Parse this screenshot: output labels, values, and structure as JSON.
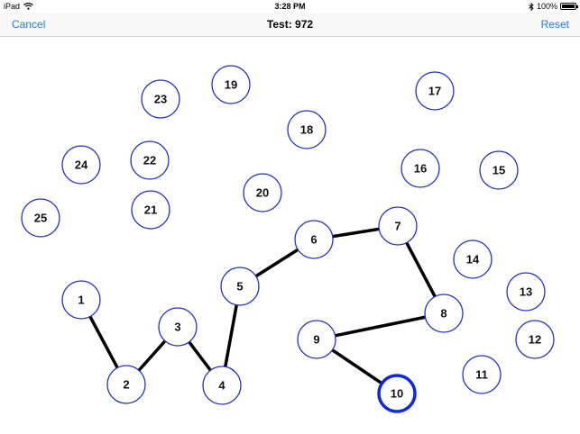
{
  "status_bar": {
    "device": "iPad",
    "wifi_icon": "wifi-icon",
    "time": "3:28 PM",
    "bluetooth_icon": "bluetooth-icon",
    "battery_percent": "100%",
    "battery_level": 1.0
  },
  "nav": {
    "cancel_label": "Cancel",
    "title": "Test: 972",
    "reset_label": "Reset",
    "accent_color": "#1e7ef0"
  },
  "nodes": [
    {
      "label": "1"
    },
    {
      "label": "2"
    },
    {
      "label": "3"
    },
    {
      "label": "4"
    },
    {
      "label": "5"
    },
    {
      "label": "6"
    },
    {
      "label": "7"
    },
    {
      "label": "8"
    },
    {
      "label": "9"
    },
    {
      "label": "10",
      "current": true
    },
    {
      "label": "11"
    },
    {
      "label": "12"
    },
    {
      "label": "13"
    },
    {
      "label": "14"
    },
    {
      "label": "15"
    },
    {
      "label": "16"
    },
    {
      "label": "17"
    },
    {
      "label": "18"
    },
    {
      "label": "19"
    },
    {
      "label": "20"
    },
    {
      "label": "21"
    },
    {
      "label": "22"
    },
    {
      "label": "23"
    },
    {
      "label": "24"
    },
    {
      "label": "25"
    }
  ],
  "completed_path": [
    "1",
    "2",
    "3",
    "4",
    "5",
    "6",
    "7",
    "8",
    "9",
    "10"
  ],
  "colors": {
    "node_border": "#2430c8",
    "current_node_border": "#1027e0",
    "path": "#000000"
  }
}
